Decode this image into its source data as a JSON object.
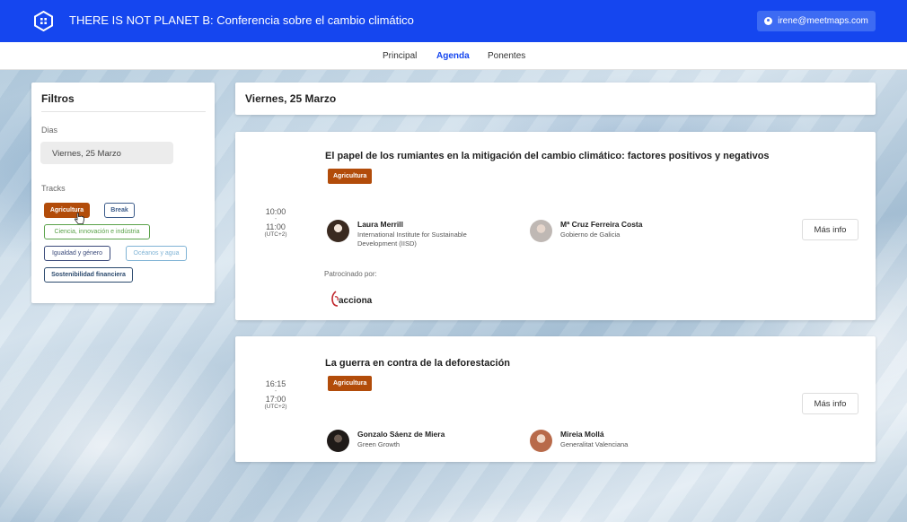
{
  "header": {
    "title": "THERE IS NOT PLANET B: Conferencia sobre el cambio climático",
    "user_email": "irene@meetmaps.com",
    "logo_icon": "hexagon-grid-icon",
    "brand_color": "#1546ef"
  },
  "nav": {
    "tabs": [
      {
        "label": "Principal",
        "active": false
      },
      {
        "label": "Agenda",
        "active": true
      },
      {
        "label": "Ponentes",
        "active": false
      }
    ]
  },
  "filters": {
    "title": "Filtros",
    "days_label": "Dias",
    "selected_day": "Viernes, 25 Marzo",
    "tracks_label": "Tracks",
    "tracks": [
      {
        "label": "Agricultura",
        "color": "#b24c0a",
        "selected": true
      },
      {
        "label": "Break",
        "color": "#3b5b8a",
        "selected": false
      },
      {
        "label": "Ciencia, innovación e indústria",
        "color": "#5aa24a",
        "selected": false
      },
      {
        "label": "Igualdad y género",
        "color": "#3a4a7a",
        "selected": false
      },
      {
        "label": "Océanos y agua",
        "color": "#7fb3d5",
        "selected": false
      },
      {
        "label": "Sostenibilidad financiera",
        "color": "#2c4a6e",
        "selected": false
      }
    ]
  },
  "agenda": {
    "date_title": "Viernes, 25 Marzo",
    "sessions": [
      {
        "start": "10:00",
        "separator": "-",
        "end": "11:00",
        "timezone": "(UTC+2)",
        "title": "El papel de los rumiantes en la mitigación del cambio climático: factores positivos y negativos",
        "tag": "Agricultura",
        "speakers": [
          {
            "name": "Laura Merrill",
            "org": "International Institute for Sustainable Development (IISD)"
          },
          {
            "name": "Mª Cruz Ferreira Costa",
            "org": "Gobierno de Galicia"
          }
        ],
        "more_label": "Más info",
        "sponsor_label": "Patrocinado por:",
        "sponsor_logo": "acciona"
      },
      {
        "start": "16:15",
        "separator": "-",
        "end": "17:00",
        "timezone": "(UTC+2)",
        "title": "La guerra en contra de la deforestación",
        "tag": "Agricultura",
        "speakers": [
          {
            "name": "Gonzalo Sáenz de Miera",
            "org": "Green Growth"
          },
          {
            "name": "Mireia Mollá",
            "org": "Generalitat Valenciana"
          }
        ],
        "more_label": "Más info"
      }
    ]
  }
}
